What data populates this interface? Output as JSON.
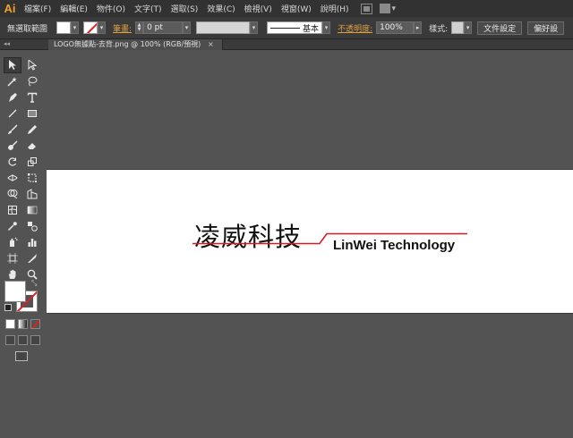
{
  "app": {
    "logo": "Ai"
  },
  "menu": [
    "檔案(F)",
    "編輯(E)",
    "物件(O)",
    "文字(T)",
    "選取(S)",
    "效果(C)",
    "檢視(V)",
    "視窗(W)",
    "說明(H)"
  ],
  "control_bar": {
    "selection_label": "無選取範圍",
    "stroke_label": "筆畫:",
    "stroke_weight": "0 pt",
    "stroke_style": "基本",
    "opacity_label": "不透明度:",
    "opacity_value": "100%",
    "style_label": "樣式:",
    "document_setup_button": "文件設定",
    "preferences_button": "偏好設"
  },
  "document": {
    "tab_title": "LOGO無據點-去背.png @ 100% (RGB/預視)",
    "close_symbol": "×"
  },
  "artwork": {
    "chinese_name": "凌威科技",
    "english_name": "LinWei Technology",
    "accent_color": "#cc1f24"
  },
  "tools_panel": {
    "collapse_symbol": "◂◂",
    "icons": [
      "selection-tool",
      "direct-selection-tool",
      "magic-wand-tool",
      "lasso-tool",
      "pen-tool",
      "type-tool",
      "line-segment-tool",
      "rectangle-tool",
      "paintbrush-tool",
      "pencil-tool",
      "blob-brush-tool",
      "eraser-tool",
      "rotate-tool",
      "scale-tool",
      "width-tool",
      "free-transform-tool",
      "shape-builder-tool",
      "perspective-grid-tool",
      "mesh-tool",
      "gradient-tool",
      "eyedropper-tool",
      "blend-tool",
      "symbol-sprayer-tool",
      "column-graph-tool",
      "artboard-tool",
      "slice-tool",
      "hand-tool",
      "zoom-tool"
    ]
  }
}
